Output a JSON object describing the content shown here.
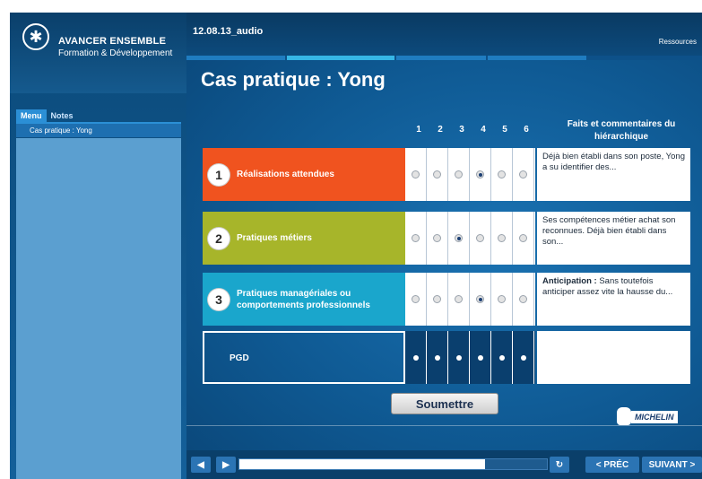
{
  "sidebar": {
    "brand_line1": "AVANCER ENSEMBLE",
    "brand_line2": "Formation & Développement",
    "tabs": [
      {
        "label": "Menu",
        "active": true
      },
      {
        "label": "Notes",
        "active": false
      }
    ],
    "menu_items": [
      {
        "label": "Cas pratique : Yong",
        "selected": true
      }
    ]
  },
  "header": {
    "file_title": "12.08.13_audio",
    "resources_label": "Ressources"
  },
  "page_title": "Cas pratique : Yong",
  "grid": {
    "columns": [
      "1",
      "2",
      "3",
      "4",
      "5",
      "6"
    ],
    "comments_header": "Faits et commentaires du hiérarchique",
    "rows": [
      {
        "number": "1",
        "label": "Réalisations attendues",
        "color": "#f0531f",
        "selected": 4,
        "comment_bold": "",
        "comment": "Déjà bien établi dans son poste, Yong a su identifier des..."
      },
      {
        "number": "2",
        "label": "Pratiques métiers",
        "color": "#a7b52a",
        "selected": 3,
        "comment_bold": "",
        "comment": "Ses compétences métier achat son reconnues. Déjà bien établi dans son..."
      },
      {
        "number": "3",
        "label": "Pratiques managériales ou comportements professionnels",
        "color": "#1aa6cc",
        "selected": 4,
        "comment_bold": "Anticipation :",
        "comment": " Sans toutefois anticiper assez vite la hausse du..."
      }
    ],
    "pgd_label": "PGD"
  },
  "submit_label": "Soumettre",
  "brand_logo": "MICHELIN",
  "controls": {
    "prev_label": "< PRÉC",
    "next_label": "SUIVANT >",
    "progress": 0.8
  },
  "colors": {
    "accent": "#2b8fd6",
    "orange": "#f0531f",
    "olive": "#a7b52a",
    "cyan": "#1aa6cc"
  },
  "icons": [
    "star-logo-icon",
    "volume-icon",
    "play-icon",
    "replay-icon"
  ]
}
